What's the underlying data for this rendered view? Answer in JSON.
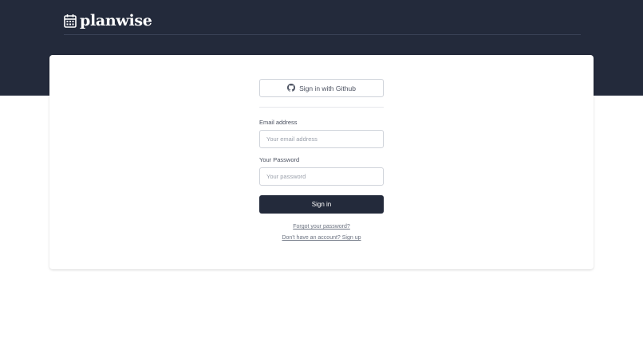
{
  "brand": {
    "name": "planwise",
    "icon": "calendar-icon"
  },
  "auth": {
    "github_label": "Sign in with Github",
    "github_icon": "github-icon",
    "email_label": "Email address",
    "email_placeholder": "Your email address",
    "email_value": "",
    "password_label": "Your Password",
    "password_placeholder": "Your password",
    "password_value": "",
    "signin_label": "Sign in",
    "forgot_link": "Forgot your password?",
    "signup_link": "Don't have an account? Sign up"
  },
  "colors": {
    "header_bg": "#232a3b",
    "primary_button": "#232a3b",
    "page_bg": "#ffffff"
  }
}
